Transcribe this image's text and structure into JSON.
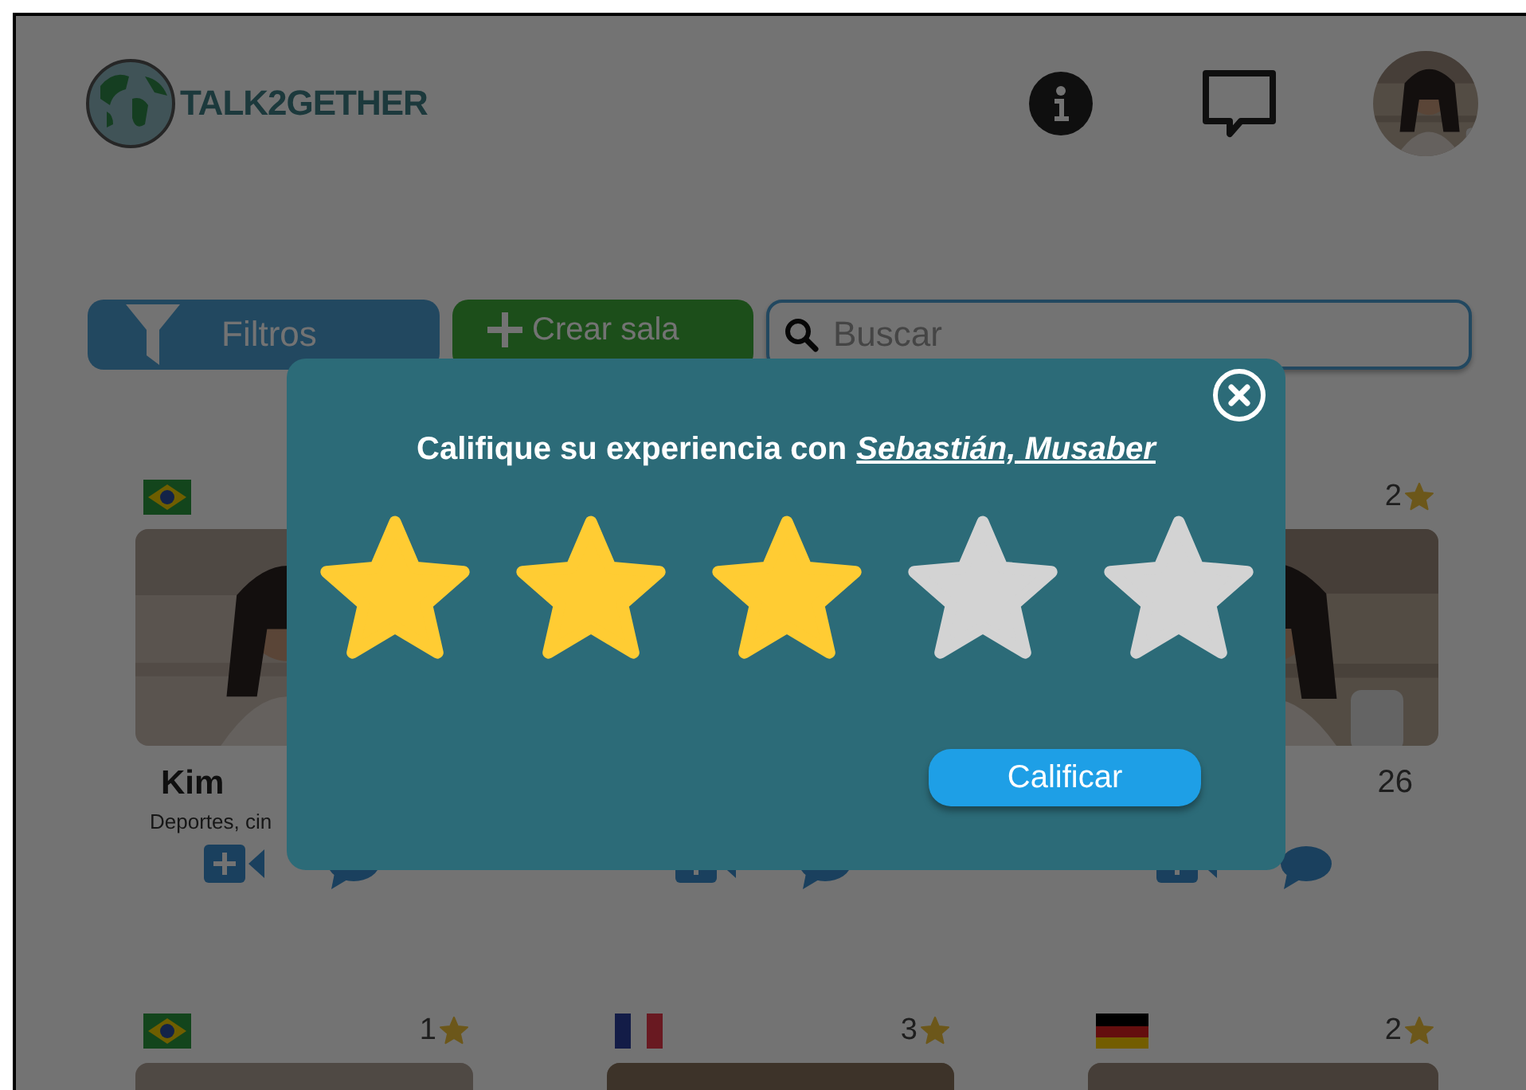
{
  "header": {
    "logo": "TALK2GETHER"
  },
  "toolbar": {
    "filter_button": "Filtros",
    "create_button": "Crear sala",
    "search": {
      "placeholder": "Buscar"
    }
  },
  "cards": [
    {
      "kind": "room",
      "flag": {
        "kind": "brazil"
      },
      "name": "Kim",
      "interests": "Deportes, cin"
    },
    {
      "kind": "covered"
    },
    {
      "kind": "room",
      "rating": "2",
      "count": "26"
    },
    {
      "kind": "cut",
      "flag": {
        "kind": "brazil"
      },
      "rating": "1"
    },
    {
      "kind": "cut",
      "flag": {
        "kind": "france"
      },
      "rating": "3"
    },
    {
      "kind": "cut",
      "flag": {
        "kind": "germany"
      },
      "rating": "2"
    }
  ],
  "dialog": {
    "prompt": "Califique su experiencia con",
    "host": "Sebastián, Musaber",
    "stars": 3,
    "submit_button": "Calificar"
  }
}
